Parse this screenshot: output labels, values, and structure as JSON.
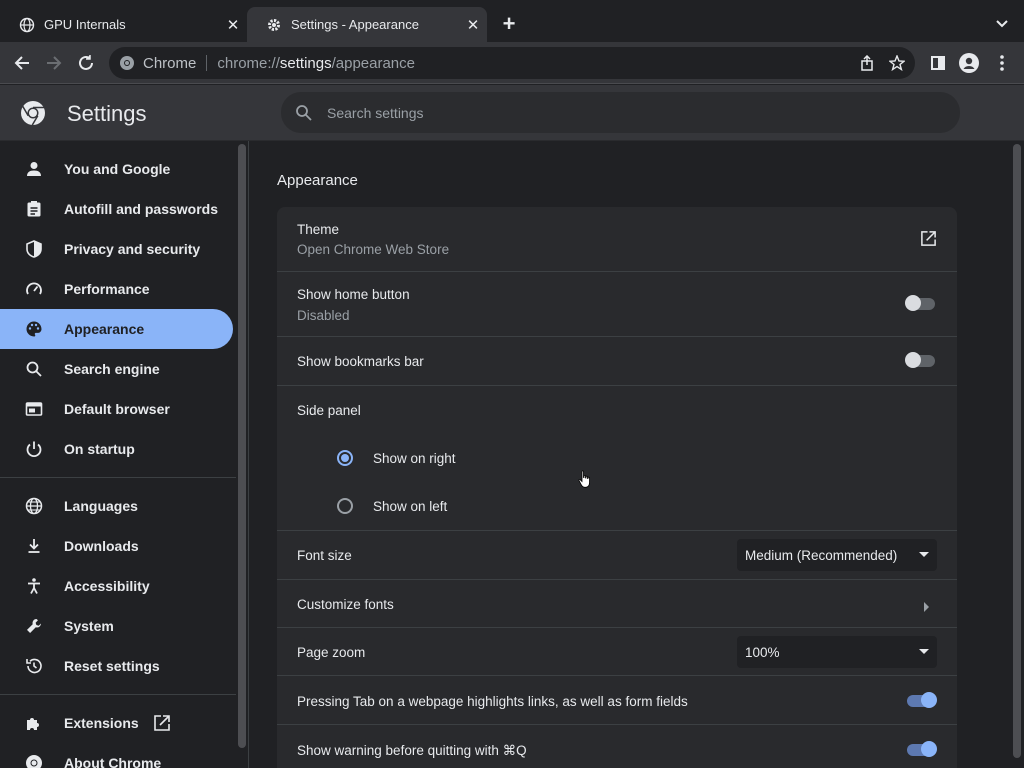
{
  "tabs": [
    {
      "title": "GPU Internals",
      "icon": "globe-icon",
      "active": false
    },
    {
      "title": "Settings - Appearance",
      "icon": "gear-icon",
      "active": true
    }
  ],
  "omnibox": {
    "chip": "Chrome",
    "url_scheme": "chrome://",
    "url_host": "settings",
    "url_path": "/appearance"
  },
  "header": {
    "title": "Settings",
    "search_placeholder": "Search settings"
  },
  "sidebar": {
    "items": [
      {
        "label": "You and Google",
        "icon": "person-icon"
      },
      {
        "label": "Autofill and passwords",
        "icon": "clipboard-icon"
      },
      {
        "label": "Privacy and security",
        "icon": "shield-icon"
      },
      {
        "label": "Performance",
        "icon": "speedometer-icon"
      },
      {
        "label": "Appearance",
        "icon": "palette-icon",
        "active": true
      },
      {
        "label": "Search engine",
        "icon": "search-icon"
      },
      {
        "label": "Default browser",
        "icon": "browser-icon"
      },
      {
        "label": "On startup",
        "icon": "power-icon"
      },
      {
        "label": "Languages",
        "icon": "globe-icon"
      },
      {
        "label": "Downloads",
        "icon": "download-icon"
      },
      {
        "label": "Accessibility",
        "icon": "accessibility-icon"
      },
      {
        "label": "System",
        "icon": "wrench-icon"
      },
      {
        "label": "Reset settings",
        "icon": "history-icon"
      },
      {
        "label": "Extensions",
        "icon": "puzzle-icon"
      },
      {
        "label": "About Chrome",
        "icon": "chrome-icon"
      }
    ]
  },
  "main": {
    "section_title": "Appearance",
    "theme": {
      "label": "Theme",
      "sub": "Open Chrome Web Store"
    },
    "home_button": {
      "label": "Show home button",
      "sub": "Disabled",
      "enabled": false
    },
    "bookmarks_bar": {
      "label": "Show bookmarks bar",
      "enabled": false
    },
    "side_panel": {
      "label": "Side panel",
      "options": [
        "Show on right",
        "Show on left"
      ],
      "selected": "Show on right"
    },
    "font_size": {
      "label": "Font size",
      "value": "Medium (Recommended)"
    },
    "customize_fonts": {
      "label": "Customize fonts"
    },
    "page_zoom": {
      "label": "Page zoom",
      "value": "100%"
    },
    "tab_highlight": {
      "label": "Pressing Tab on a webpage highlights links, as well as form fields",
      "enabled": true
    },
    "quit_warning": {
      "label": "Show warning before quitting with ⌘Q",
      "enabled": true
    }
  },
  "colors": {
    "accent": "#8ab4f8",
    "background": "#202124",
    "card": "#292a2d",
    "toolbar": "#35363a"
  }
}
